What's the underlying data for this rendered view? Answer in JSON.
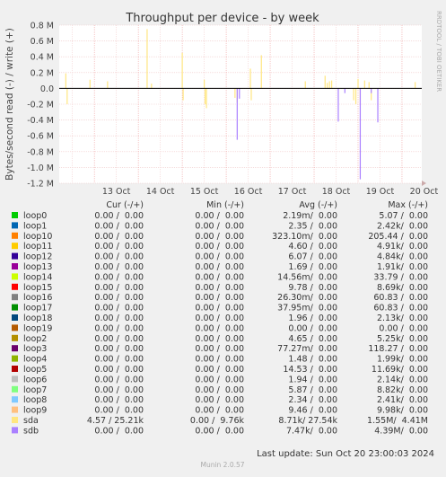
{
  "chart_data": {
    "type": "line",
    "title": "Throughput per device - by week",
    "ylabel": "Bytes/second read (-) / write (+)",
    "side_label": "RRDTOOL / TOBI OETIKER",
    "footer": "Munin 2.0.57",
    "last_update": "Last update: Sun Oct 20 23:00:03 2024",
    "ylim": [
      -1200000,
      800000
    ],
    "y_ticks": [
      {
        "value": 800000,
        "label": "0.8 M"
      },
      {
        "value": 600000,
        "label": "0.6 M"
      },
      {
        "value": 400000,
        "label": "0.4 M"
      },
      {
        "value": 200000,
        "label": "0.2 M"
      },
      {
        "value": 0,
        "label": "0.0"
      },
      {
        "value": -200000,
        "label": "-0.2 M"
      },
      {
        "value": -400000,
        "label": "-0.4 M"
      },
      {
        "value": -600000,
        "label": "-0.6 M"
      },
      {
        "value": -800000,
        "label": "-0.8 M"
      },
      {
        "value": -1000000,
        "label": "-1.0 M"
      },
      {
        "value": -1200000,
        "label": "-1.2 M"
      }
    ],
    "x_range_days": [
      12.2,
      20.45
    ],
    "x_ticks": [
      {
        "day": 13,
        "label": "13 Oct"
      },
      {
        "day": 14,
        "label": "14 Oct"
      },
      {
        "day": 15,
        "label": "15 Oct"
      },
      {
        "day": 16,
        "label": "16 Oct"
      },
      {
        "day": 17,
        "label": "17 Oct"
      },
      {
        "day": 18,
        "label": "18 Oct"
      },
      {
        "day": 19,
        "label": "19 Oct"
      },
      {
        "day": 20,
        "label": "20 Oct"
      }
    ],
    "grid": true,
    "legend_headers": [
      "Cur (-/+)",
      "Min (-/+)",
      "Avg (-/+)",
      "Max (-/+)"
    ],
    "series": [
      {
        "name": "loop0",
        "color": "#00cc00",
        "cur": "0.00 /  0.00",
        "min": "0.00 /  0.00",
        "avg": "2.19m/  0.00",
        "max": "5.07 /  0.00"
      },
      {
        "name": "loop1",
        "color": "#0066b3",
        "cur": "0.00 /  0.00",
        "min": "0.00 /  0.00",
        "avg": "2.35 /  0.00",
        "max": "2.42k/  0.00"
      },
      {
        "name": "loop10",
        "color": "#ff8000",
        "cur": "0.00 /  0.00",
        "min": "0.00 /  0.00",
        "avg": "323.10m/  0.00",
        "max": "205.44 /  0.00"
      },
      {
        "name": "loop11",
        "color": "#ffcc00",
        "cur": "0.00 /  0.00",
        "min": "0.00 /  0.00",
        "avg": "4.60 /  0.00",
        "max": "4.91k/  0.00"
      },
      {
        "name": "loop12",
        "color": "#330099",
        "cur": "0.00 /  0.00",
        "min": "0.00 /  0.00",
        "avg": "6.07 /  0.00",
        "max": "4.84k/  0.00"
      },
      {
        "name": "loop13",
        "color": "#990099",
        "cur": "0.00 /  0.00",
        "min": "0.00 /  0.00",
        "avg": "1.69 /  0.00",
        "max": "1.91k/  0.00"
      },
      {
        "name": "loop14",
        "color": "#ccff00",
        "cur": "0.00 /  0.00",
        "min": "0.00 /  0.00",
        "avg": "14.56m/  0.00",
        "max": "33.79 /  0.00"
      },
      {
        "name": "loop15",
        "color": "#ff0000",
        "cur": "0.00 /  0.00",
        "min": "0.00 /  0.00",
        "avg": "9.78 /  0.00",
        "max": "8.69k/  0.00"
      },
      {
        "name": "loop16",
        "color": "#808080",
        "cur": "0.00 /  0.00",
        "min": "0.00 /  0.00",
        "avg": "26.30m/  0.00",
        "max": "60.83 /  0.00"
      },
      {
        "name": "loop17",
        "color": "#008f00",
        "cur": "0.00 /  0.00",
        "min": "0.00 /  0.00",
        "avg": "37.95m/  0.00",
        "max": "60.83 /  0.00"
      },
      {
        "name": "loop18",
        "color": "#00487d",
        "cur": "0.00 /  0.00",
        "min": "0.00 /  0.00",
        "avg": "1.96 /  0.00",
        "max": "2.13k/  0.00"
      },
      {
        "name": "loop19",
        "color": "#b35a00",
        "cur": "0.00 /  0.00",
        "min": "0.00 /  0.00",
        "avg": "0.00 /  0.00",
        "max": "0.00 /  0.00"
      },
      {
        "name": "loop2",
        "color": "#b38f00",
        "cur": "0.00 /  0.00",
        "min": "0.00 /  0.00",
        "avg": "4.65 /  0.00",
        "max": "5.25k/  0.00"
      },
      {
        "name": "loop3",
        "color": "#6b006b",
        "cur": "0.00 /  0.00",
        "min": "0.00 /  0.00",
        "avg": "77.27m/  0.00",
        "max": "118.27 /  0.00"
      },
      {
        "name": "loop4",
        "color": "#8fb300",
        "cur": "0.00 /  0.00",
        "min": "0.00 /  0.00",
        "avg": "1.48 /  0.00",
        "max": "1.99k/  0.00"
      },
      {
        "name": "loop5",
        "color": "#b30000",
        "cur": "0.00 /  0.00",
        "min": "0.00 /  0.00",
        "avg": "14.53 /  0.00",
        "max": "11.69k/  0.00"
      },
      {
        "name": "loop6",
        "color": "#bebebe",
        "cur": "0.00 /  0.00",
        "min": "0.00 /  0.00",
        "avg": "1.94 /  0.00",
        "max": "2.14k/  0.00"
      },
      {
        "name": "loop7",
        "color": "#80ff80",
        "cur": "0.00 /  0.00",
        "min": "0.00 /  0.00",
        "avg": "5.87 /  0.00",
        "max": "8.82k/  0.00"
      },
      {
        "name": "loop8",
        "color": "#80c9ff",
        "cur": "0.00 /  0.00",
        "min": "0.00 /  0.00",
        "avg": "2.34 /  0.00",
        "max": "2.41k/  0.00"
      },
      {
        "name": "loop9",
        "color": "#ffc080",
        "cur": "0.00 /  0.00",
        "min": "0.00 /  0.00",
        "avg": "9.46 /  0.00",
        "max": "9.98k/  0.00"
      },
      {
        "name": "sda",
        "color": "#ffe680",
        "cur": "4.57 / 25.21k",
        "min": "0.00 /  9.76k",
        "avg": "8.71k/ 27.54k",
        "max": "1.55M/  4.41M"
      },
      {
        "name": "sdb",
        "color": "#aa80ff",
        "cur": "0.00 /  0.00",
        "min": "0.00 /  0.00",
        "avg": "7.47k/  0.00",
        "max": "4.39M/  0.00"
      }
    ],
    "spikes": [
      {
        "series": "sda",
        "day": 12.35,
        "value": 190000
      },
      {
        "series": "sda",
        "day": 12.38,
        "value": -200000
      },
      {
        "series": "sda",
        "day": 12.9,
        "value": 110000
      },
      {
        "series": "sda",
        "day": 13.3,
        "value": 90000
      },
      {
        "series": "sda",
        "day": 14.2,
        "value": 750000
      },
      {
        "series": "sda",
        "day": 14.3,
        "value": 60000
      },
      {
        "series": "sda",
        "day": 15.0,
        "value": 450000
      },
      {
        "series": "sda",
        "day": 15.02,
        "value": -150000
      },
      {
        "series": "sda",
        "day": 15.5,
        "value": 110000
      },
      {
        "series": "sda",
        "day": 15.52,
        "value": -200000
      },
      {
        "series": "sda",
        "day": 15.55,
        "value": -250000
      },
      {
        "series": "sda",
        "day": 16.2,
        "value": -120000
      },
      {
        "series": "sda",
        "day": 16.25,
        "value": -180000
      },
      {
        "series": "sda",
        "day": 16.55,
        "value": 250000
      },
      {
        "series": "sda",
        "day": 16.57,
        "value": -150000
      },
      {
        "series": "sda",
        "day": 16.8,
        "value": 420000
      },
      {
        "series": "sda",
        "day": 17.8,
        "value": 90000
      },
      {
        "series": "sda",
        "day": 18.25,
        "value": 160000
      },
      {
        "series": "sda",
        "day": 18.3,
        "value": 70000
      },
      {
        "series": "sda",
        "day": 18.35,
        "value": 90000
      },
      {
        "series": "sda",
        "day": 18.4,
        "value": 100000
      },
      {
        "series": "sda",
        "day": 18.9,
        "value": -150000
      },
      {
        "series": "sda",
        "day": 18.95,
        "value": -200000
      },
      {
        "series": "sda",
        "day": 19.0,
        "value": 120000
      },
      {
        "series": "sda",
        "day": 19.05,
        "value": -180000
      },
      {
        "series": "sda",
        "day": 19.15,
        "value": 100000
      },
      {
        "series": "sda",
        "day": 19.25,
        "value": 80000
      },
      {
        "series": "sda",
        "day": 19.3,
        "value": -150000
      },
      {
        "series": "sda",
        "day": 20.3,
        "value": 80000
      },
      {
        "series": "sdb",
        "day": 16.25,
        "value": -650000
      },
      {
        "series": "sdb",
        "day": 16.3,
        "value": -130000
      },
      {
        "series": "sdb",
        "day": 18.55,
        "value": -420000
      },
      {
        "series": "sdb",
        "day": 18.7,
        "value": -60000
      },
      {
        "series": "sdb",
        "day": 19.05,
        "value": -1150000
      },
      {
        "series": "sdb",
        "day": 19.3,
        "value": -60000
      },
      {
        "series": "sdb",
        "day": 19.45,
        "value": -430000
      }
    ]
  }
}
